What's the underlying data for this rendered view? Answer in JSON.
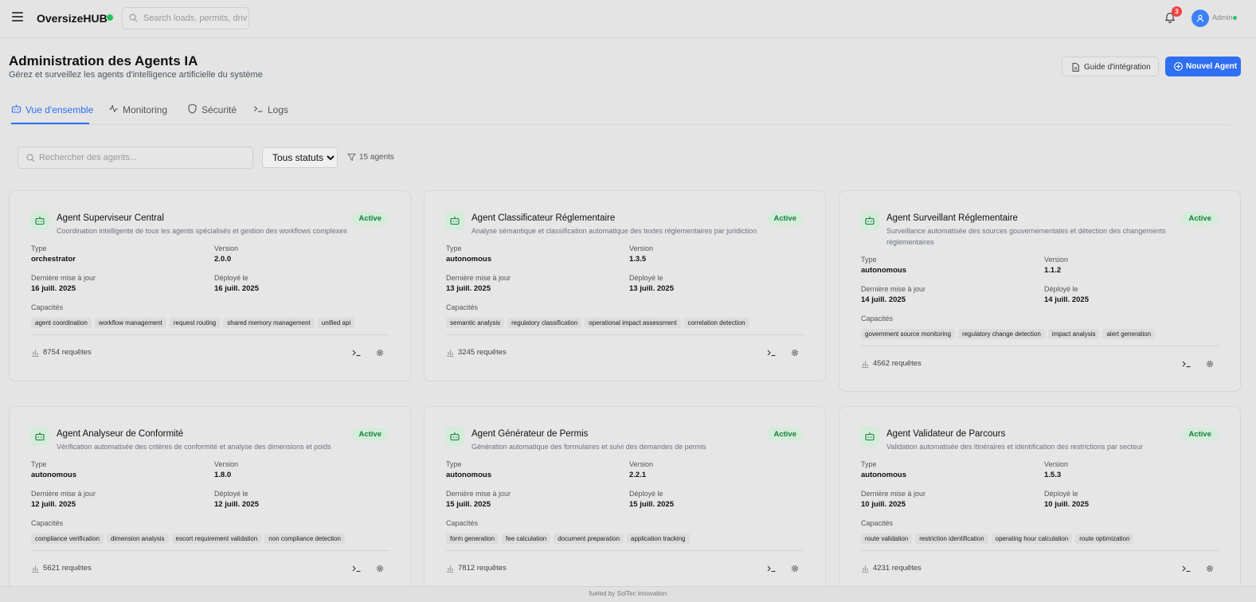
{
  "topbar": {
    "brand": "OversizeHUB",
    "search_placeholder": "Search loads, permits, drivers...",
    "notification_count": "3",
    "user_label": "Admin"
  },
  "header": {
    "title": "Administration des Agents IA",
    "subtitle": "Gérez et surveillez les agents d'intelligence artificielle du système",
    "guide_button": "Guide d'intégration",
    "new_agent_button": "Nouvel Agent"
  },
  "tabs": [
    {
      "label": "Vue d'ensemble",
      "icon": "bot-icon",
      "active": true
    },
    {
      "label": "Monitoring",
      "icon": "activity-icon",
      "active": false
    },
    {
      "label": "Sécurité",
      "icon": "shield-icon",
      "active": false
    },
    {
      "label": "Logs",
      "icon": "terminal-icon",
      "active": false
    }
  ],
  "filters": {
    "search_placeholder": "Rechercher des agents...",
    "status_selected": "Tous statuts",
    "count": "15 agents"
  },
  "labels": {
    "type": "Type",
    "version": "Version",
    "updated": "Dernière mise à jour",
    "deployed": "Déployé le",
    "capabilities": "Capacités"
  },
  "agents": [
    {
      "name": "Agent Superviseur Central",
      "description": "Coordination intelligente de tous les agents spécialisés et gestion des workflows complexes",
      "status": "Active",
      "type": "orchestrator",
      "version": "2.0.0",
      "updated": "16 juill. 2025",
      "deployed": "16 juill. 2025",
      "capabilities": [
        "agent coordination",
        "workflow management",
        "request routing",
        "shared memory management",
        "unified api"
      ],
      "requests": "8754 requêtes"
    },
    {
      "name": "Agent Classificateur Réglementaire",
      "description": "Analyse sémantique et classification automatique des textes réglementaires par juridiction",
      "status": "Active",
      "type": "autonomous",
      "version": "1.3.5",
      "updated": "13 juill. 2025",
      "deployed": "13 juill. 2025",
      "capabilities": [
        "semantic analysis",
        "regulatory classification",
        "operational impact assessment",
        "correlation detection"
      ],
      "requests": "3245 requêtes"
    },
    {
      "name": "Agent Surveillant Réglementaire",
      "description": "Surveillance automatisée des sources gouvernementales et détection des changements réglementaires",
      "status": "Active",
      "type": "autonomous",
      "version": "1.1.2",
      "updated": "14 juill. 2025",
      "deployed": "14 juill. 2025",
      "capabilities": [
        "government source monitoring",
        "regulatory change detection",
        "impact analysis",
        "alert generation"
      ],
      "requests": "4562 requêtes"
    },
    {
      "name": "Agent Analyseur de Conformité",
      "description": "Vérification automatisée des critères de conformité et analyse des dimensions et poids",
      "status": "Active",
      "type": "autonomous",
      "version": "1.8.0",
      "updated": "12 juill. 2025",
      "deployed": "12 juill. 2025",
      "capabilities": [
        "compliance verification",
        "dimension analysis",
        "escort requirement validation",
        "non compliance detection"
      ],
      "requests": "5621 requêtes"
    },
    {
      "name": "Agent Générateur de Permis",
      "description": "Génération automatique des formulaires et suivi des demandes de permis",
      "status": "Active",
      "type": "autonomous",
      "version": "2.2.1",
      "updated": "15 juill. 2025",
      "deployed": "15 juill. 2025",
      "capabilities": [
        "form generation",
        "fee calculation",
        "document preparation",
        "application tracking"
      ],
      "requests": "7812 requêtes"
    },
    {
      "name": "Agent Validateur de Parcours",
      "description": "Validation automatisée des itinéraires et identification des restrictions par secteur",
      "status": "Active",
      "type": "autonomous",
      "version": "1.5.3",
      "updated": "10 juill. 2025",
      "deployed": "10 juill. 2025",
      "capabilities": [
        "route validation",
        "restriction identification",
        "operating hour calculation",
        "route optimization"
      ],
      "requests": "4231 requêtes"
    }
  ],
  "footer": "fueled by SolTec innovation",
  "colors": {
    "accent": "#2f6ff3",
    "active_badge_bg": "#d4ecd9",
    "active_badge_text": "#16803c",
    "brand_dot": "#22c55e",
    "notification": "#ef4444"
  }
}
